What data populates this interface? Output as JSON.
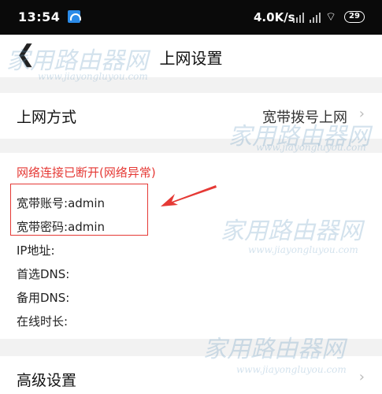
{
  "status_bar": {
    "time": "13:54",
    "speed": "4.0K/s",
    "wifi_glyph": "⌔",
    "battery": "29"
  },
  "nav": {
    "back_glyph": "❮",
    "title": "上网设置"
  },
  "connection": {
    "label": "上网方式",
    "value": "宽带拨号上网",
    "chevron": "›"
  },
  "status": {
    "error": "网络连接已断开(网络异常)",
    "account_label": "宽带账号:",
    "account_value": "admin",
    "password_label": "宽带密码:",
    "password_value": "admin",
    "ip_label": "IP地址:",
    "dns1_label": "首选DNS:",
    "dns2_label": "备用DNS:",
    "online_label": "在线时长:"
  },
  "advanced": {
    "label": "高级设置",
    "chevron": "›"
  },
  "watermark": {
    "cn": "家用路由器网",
    "en": "www.jiayongluyou.com"
  },
  "colors": {
    "error": "#e53935",
    "annotation": "#e53935",
    "divider": "#f2f2f2"
  }
}
